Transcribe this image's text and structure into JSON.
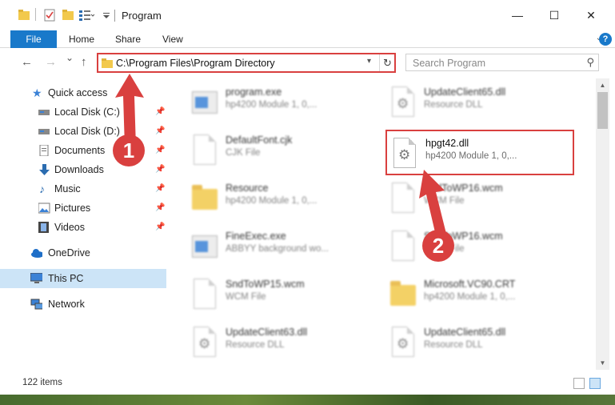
{
  "window": {
    "title": "Program",
    "minimize_glyph": "—",
    "maximize_glyph": "☐",
    "close_glyph": "✕"
  },
  "ribbon": {
    "tabs": [
      {
        "label": "File"
      },
      {
        "label": "Home"
      },
      {
        "label": "Share"
      },
      {
        "label": "View"
      }
    ],
    "help_glyph": "?"
  },
  "nav": {
    "back_glyph": "←",
    "forward_glyph": "→",
    "recent_glyph": "⌄",
    "up_glyph": "↑",
    "address": "C:\\Program Files\\Program Directory",
    "search_placeholder": "Search Program"
  },
  "sidebar": {
    "items": [
      {
        "label": "Quick access",
        "icon": "star-icon"
      },
      {
        "label": "Local Disk (C:)",
        "icon": "disk-icon",
        "pinned": true
      },
      {
        "label": "Local Disk (D:)",
        "icon": "disk-icon",
        "pinned": true
      },
      {
        "label": "Documents",
        "icon": "documents-icon",
        "pinned": true
      },
      {
        "label": "Downloads",
        "icon": "download-icon",
        "pinned": true
      },
      {
        "label": "Music",
        "icon": "music-icon",
        "pinned": true
      },
      {
        "label": "Pictures",
        "icon": "pictures-icon",
        "pinned": true
      },
      {
        "label": "Videos",
        "icon": "videos-icon",
        "pinned": true
      },
      {
        "label": "OneDrive",
        "icon": "cloud-icon"
      },
      {
        "label": "This PC",
        "icon": "pc-icon",
        "selected": true
      },
      {
        "label": "Network",
        "icon": "network-icon"
      }
    ]
  },
  "files": [
    {
      "name": "program.exe",
      "desc": "hp4200 Module 1, 0,...",
      "icon": "exe-icon"
    },
    {
      "name": "UpdateClient65.dll",
      "desc": "Resource DLL",
      "icon": "dll-icon"
    },
    {
      "name": "DefaultFont.cjk",
      "desc": "CJK File",
      "icon": "file-icon"
    },
    {
      "name": "Resource",
      "desc": "hp4200 Module 1, 0,...",
      "icon": "folder-icon"
    },
    {
      "name": "SndToWP16.wcm",
      "desc": "WCM File",
      "icon": "file-icon"
    },
    {
      "name": "FineExec.exe",
      "desc": "ABBYY background wo...",
      "icon": "app-icon"
    },
    {
      "name": "SndToWP16.wcm",
      "desc": "WCM File",
      "icon": "file-icon"
    },
    {
      "name": "SndToWP15.wcm",
      "desc": "WCM File",
      "icon": "file-icon"
    },
    {
      "name": "Microsoft.VC90.CRT",
      "desc": "hp4200 Module 1, 0,...",
      "icon": "folder-icon"
    },
    {
      "name": "UpdateClient63.dll",
      "desc": "Resource DLL",
      "icon": "dll-icon"
    },
    {
      "name": "UpdateClient65.dll",
      "desc": "Resource DLL",
      "icon": "dll-icon"
    }
  ],
  "highlighted_file": {
    "name": "hpgt42.dll",
    "desc": "hp4200 Module 1, 0,...",
    "icon": "dll-icon"
  },
  "status": {
    "count": "122 items"
  },
  "annotations": [
    {
      "label": "1"
    },
    {
      "label": "2"
    }
  ],
  "colors": {
    "accent": "#1979ca",
    "annotation": "#d9403f",
    "selected": "#cce4f7"
  }
}
